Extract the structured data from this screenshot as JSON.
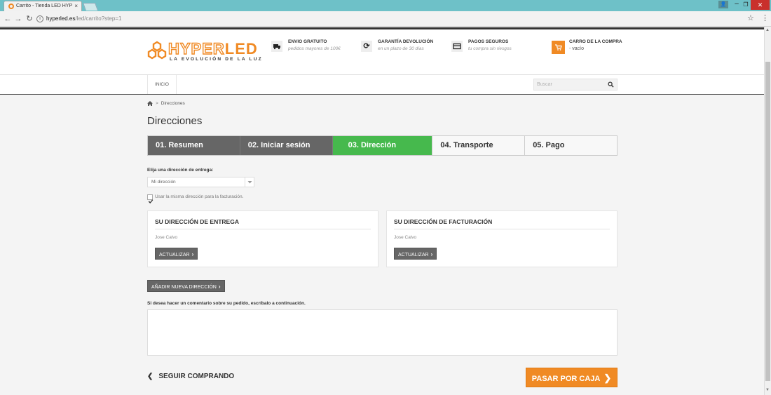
{
  "browser": {
    "tab_title": "Carrito - Tienda LED HYP",
    "tab_close": "×",
    "url_host": "hyperled.es",
    "url_path": "/led/carrito?step=1"
  },
  "header": {
    "logo_hyper": "HYPER",
    "logo_led": "LED",
    "tagline": "LA EVOLUCIÓN DE LA LUZ",
    "features": [
      {
        "title": "ENVIO GRATUITO",
        "sub": "pedidos mayores de 100€"
      },
      {
        "title": "GARANTÍA DEVOLUCIÓN",
        "sub": "en un plazo de 30 días"
      },
      {
        "title": "PAGOS SEGUROS",
        "sub": "tu compra sin riesgos"
      }
    ],
    "cart": {
      "title": "CARRO DE LA COMPRA",
      "sub": "- vacío"
    }
  },
  "menu": {
    "inicio": "INICIO",
    "search_placeholder": "Buscar"
  },
  "breadcrumb": {
    "current": "Direcciones",
    "separator": ">"
  },
  "page_title": "Direcciones",
  "steps": [
    {
      "label": "01. Resumen",
      "state": "done"
    },
    {
      "label": "02. Iniciar sesión",
      "state": "done"
    },
    {
      "label": "03. Dirección",
      "state": "current"
    },
    {
      "label": "04. Transporte",
      "state": "todo"
    },
    {
      "label": "05. Pago",
      "state": "todo"
    }
  ],
  "address_form": {
    "choose_label": "Elija una dirección de entrega:",
    "selected_address": "Mi dirección",
    "same_billing_label": "Usar la misma dirección para la facturación."
  },
  "delivery_card": {
    "title": "SU DIRECCIÓN DE ENTREGA",
    "name": "Jose Calvo",
    "update_label": "ACTUALIZAR"
  },
  "billing_card": {
    "title": "SU DIRECCIÓN DE FACTURACIÓN",
    "name": "Jose Calvo",
    "update_label": "ACTUALIZAR"
  },
  "add_address_label": "AÑADIR NUEVA DIRECCIÓN",
  "comment_label": "Si desea hacer un comentario sobre su pedido, escríbalo a continuación.",
  "continue_shopping_label": "SEGUIR COMPRANDO",
  "checkout_label": "PASAR POR CAJA",
  "colors": {
    "brand_orange": "#f08a24",
    "step_current": "#46b94d",
    "step_done": "#666666"
  }
}
